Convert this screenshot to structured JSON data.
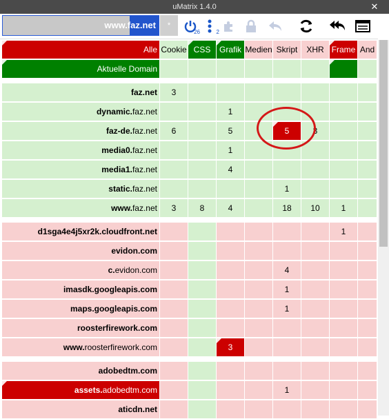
{
  "window": {
    "title": "uMatrix 1.4.0",
    "close_icon": "close-icon"
  },
  "toolbar": {
    "scope_text": "www.faz.net",
    "scope_star": "*",
    "power_count": "26",
    "list_count": "2"
  },
  "columns": [
    "Alle",
    "Cookie",
    "CSS",
    "Grafik",
    "Medien",
    "Skript",
    "XHR",
    "Frame",
    "And"
  ],
  "column_states": [
    "dr",
    "g",
    "dg",
    "dg",
    "r",
    "r",
    "r",
    "dr",
    "r"
  ],
  "domain_row": {
    "label": "Aktuelle Domain",
    "state": "dg"
  },
  "rows": [
    {
      "label": "faz.net",
      "dom": "faz.net",
      "state": "g",
      "cells": [
        "3",
        "",
        "",
        "",
        "",
        "",
        "",
        ""
      ],
      "cell_states": [
        "g",
        "g",
        "g",
        "g",
        "g",
        "g",
        "g",
        "g"
      ]
    },
    {
      "label": "dynamic.faz.net",
      "dom": "faz.net",
      "state": "g",
      "cells": [
        "",
        "",
        "1",
        "",
        "",
        "",
        "",
        ""
      ],
      "cell_states": [
        "g",
        "g",
        "g",
        "g",
        "g",
        "g",
        "g",
        "g"
      ]
    },
    {
      "label": "faz-de.faz.net",
      "dom": "faz.net",
      "state": "g",
      "cells": [
        "6",
        "",
        "5",
        "",
        "5",
        "3",
        "",
        ""
      ],
      "cell_states": [
        "g",
        "g",
        "g",
        "g",
        "dr",
        "g",
        "g",
        "g"
      ]
    },
    {
      "label": "media0.faz.net",
      "dom": "faz.net",
      "state": "g",
      "cells": [
        "",
        "",
        "1",
        "",
        "",
        "",
        "",
        ""
      ],
      "cell_states": [
        "g",
        "g",
        "g",
        "g",
        "g",
        "g",
        "g",
        "g"
      ]
    },
    {
      "label": "media1.faz.net",
      "dom": "faz.net",
      "state": "g",
      "cells": [
        "",
        "",
        "4",
        "",
        "",
        "",
        "",
        ""
      ],
      "cell_states": [
        "g",
        "g",
        "g",
        "g",
        "g",
        "g",
        "g",
        "g"
      ]
    },
    {
      "label": "static.faz.net",
      "dom": "faz.net",
      "state": "g",
      "cells": [
        "",
        "",
        "",
        "",
        "1",
        "",
        "",
        ""
      ],
      "cell_states": [
        "g",
        "g",
        "g",
        "g",
        "g",
        "g",
        "g",
        "g"
      ]
    },
    {
      "label": "www.faz.net",
      "dom": "faz.net",
      "state": "g",
      "cells": [
        "3",
        "8",
        "4",
        "",
        "18",
        "10",
        "1",
        ""
      ],
      "cell_states": [
        "g",
        "g",
        "g",
        "g",
        "g",
        "g",
        "g",
        "g"
      ]
    },
    {
      "label": "d1sga4e4j5xr2k.cloudfront.net",
      "dom": "d1sga4e4j5xr2k.cloudfront.net",
      "state": "r",
      "cells": [
        "",
        "",
        "",
        "",
        "",
        "",
        "1",
        ""
      ],
      "cell_states": [
        "r",
        "g",
        "r",
        "r",
        "r",
        "r",
        "r",
        "r"
      ]
    },
    {
      "label": "evidon.com",
      "dom": "evidon.com",
      "state": "r",
      "cells": [
        "",
        "",
        "",
        "",
        "",
        "",
        "",
        ""
      ],
      "cell_states": [
        "r",
        "g",
        "r",
        "r",
        "r",
        "r",
        "r",
        "r"
      ]
    },
    {
      "label": "c.evidon.com",
      "dom": "evidon.com",
      "state": "r",
      "cells": [
        "",
        "",
        "",
        "",
        "4",
        "",
        "",
        ""
      ],
      "cell_states": [
        "r",
        "g",
        "r",
        "r",
        "r",
        "r",
        "r",
        "r"
      ]
    },
    {
      "label": "imasdk.googleapis.com",
      "dom": "imasdk.googleapis.com",
      "state": "r",
      "cells": [
        "",
        "",
        "",
        "",
        "1",
        "",
        "",
        ""
      ],
      "cell_states": [
        "r",
        "g",
        "r",
        "r",
        "r",
        "r",
        "r",
        "r"
      ]
    },
    {
      "label": "maps.googleapis.com",
      "dom": "maps.googleapis.com",
      "state": "r",
      "cells": [
        "",
        "",
        "",
        "",
        "1",
        "",
        "",
        ""
      ],
      "cell_states": [
        "r",
        "g",
        "r",
        "r",
        "r",
        "r",
        "r",
        "r"
      ]
    },
    {
      "label": "roosterfirework.com",
      "dom": "roosterfirework.com",
      "state": "r",
      "cells": [
        "",
        "",
        "",
        "",
        "",
        "",
        "",
        ""
      ],
      "cell_states": [
        "r",
        "g",
        "r",
        "r",
        "r",
        "r",
        "r",
        "r"
      ]
    },
    {
      "label": "www.roosterfirework.com",
      "dom": "roosterfirework.com",
      "state": "r",
      "cells": [
        "",
        "",
        "3",
        "",
        "",
        "",
        "",
        ""
      ],
      "cell_states": [
        "r",
        "g",
        "dr",
        "r",
        "r",
        "r",
        "r",
        "r"
      ]
    },
    {
      "label": "adobedtm.com",
      "dom": "adobedtm.com",
      "state": "r",
      "cells": [
        "",
        "",
        "",
        "",
        "",
        "",
        "",
        ""
      ],
      "cell_states": [
        "r",
        "g",
        "r",
        "r",
        "r",
        "r",
        "r",
        "r"
      ]
    },
    {
      "label": "assets.adobedtm.com",
      "dom": "adobedtm.com",
      "state": "dr",
      "cells": [
        "",
        "",
        "",
        "",
        "1",
        "",
        "",
        ""
      ],
      "cell_states": [
        "r",
        "g",
        "r",
        "r",
        "r",
        "r",
        "r",
        "r"
      ]
    },
    {
      "label": "aticdn.net",
      "dom": "aticdn.net",
      "state": "r",
      "cells": [
        "",
        "",
        "",
        "",
        "",
        "",
        "",
        ""
      ],
      "cell_states": [
        "r",
        "g",
        "r",
        "r",
        "r",
        "r",
        "r",
        "r"
      ]
    }
  ],
  "colors": {
    "allowed": "#d5f0cf",
    "blocked": "#f8d0d0",
    "allowed_explicit": "#008000",
    "blocked_explicit": "#cc0000",
    "accent": "#2255cc"
  }
}
